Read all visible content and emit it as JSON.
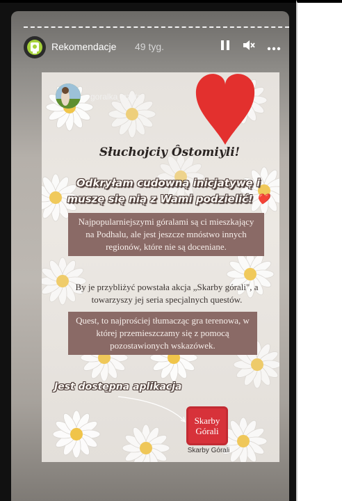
{
  "header": {
    "account_name": "Rekomendacje",
    "time_ago": "49 tyg.",
    "icons": [
      "pause-icon",
      "mute-icon",
      "more-icon"
    ]
  },
  "post": {
    "username": "goralka_czyta",
    "headline": "Słuchojciy Ôstomiyli!",
    "subline_1": "Odkryłam cudowną inicjatywę i",
    "subline_2": "muszę się nią z Wami podzielić!",
    "subline_heart": "❤️",
    "box1": "Najpopularniejszymi góralami są ci mieszkający na Podhalu, ale jest jeszcze mnóstwo innych regionów, które nie są doceniane.",
    "paragraph": "By je przybliżyć powstała akcja „Skarby górali\", a towarzyszy jej seria specjalnych questów.",
    "box2": "Quest, to najprościej tłumacząc gra terenowa, w której przemieszczamy się z pomocą pozostawionych wskazówek.",
    "app_available": "Jest dostępna aplikacja",
    "app_icon_text": "Skarby Górali",
    "app_icon_label": "Skarby Górali"
  },
  "colors": {
    "heart": "#e3302e",
    "box_bg": "#8a6a66",
    "logo_green": "#a6d23a",
    "app_red": "#d7323a"
  }
}
